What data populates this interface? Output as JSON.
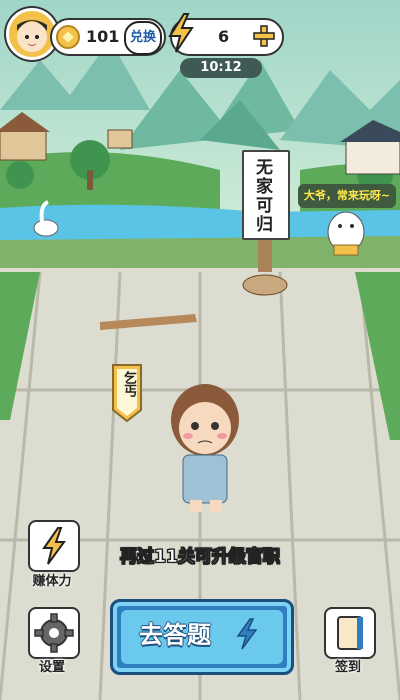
{
  "top_bar": {
    "coins": "101",
    "exchange_label": "兑换",
    "energy": "6",
    "timer": "10:12"
  },
  "scene": {
    "signpost_text": "无家可归",
    "cat_speech": "大爷，常来玩呀~",
    "character_title": "乞丐"
  },
  "upgrade_hint": "再过11关可升级官职",
  "buttons": {
    "stamina_label": "赚体力",
    "settings_label": "设置",
    "answer_label": "去答题",
    "checkin_label": "签到"
  },
  "colors": {
    "sky": "#bfe6d6",
    "mountain": "#6fb9a0",
    "grass": "#5dab5a",
    "water": "#59c4e6",
    "ground": "#dcdcd0",
    "main_button": "#2f7fc0",
    "gold": "#f3c14a"
  }
}
